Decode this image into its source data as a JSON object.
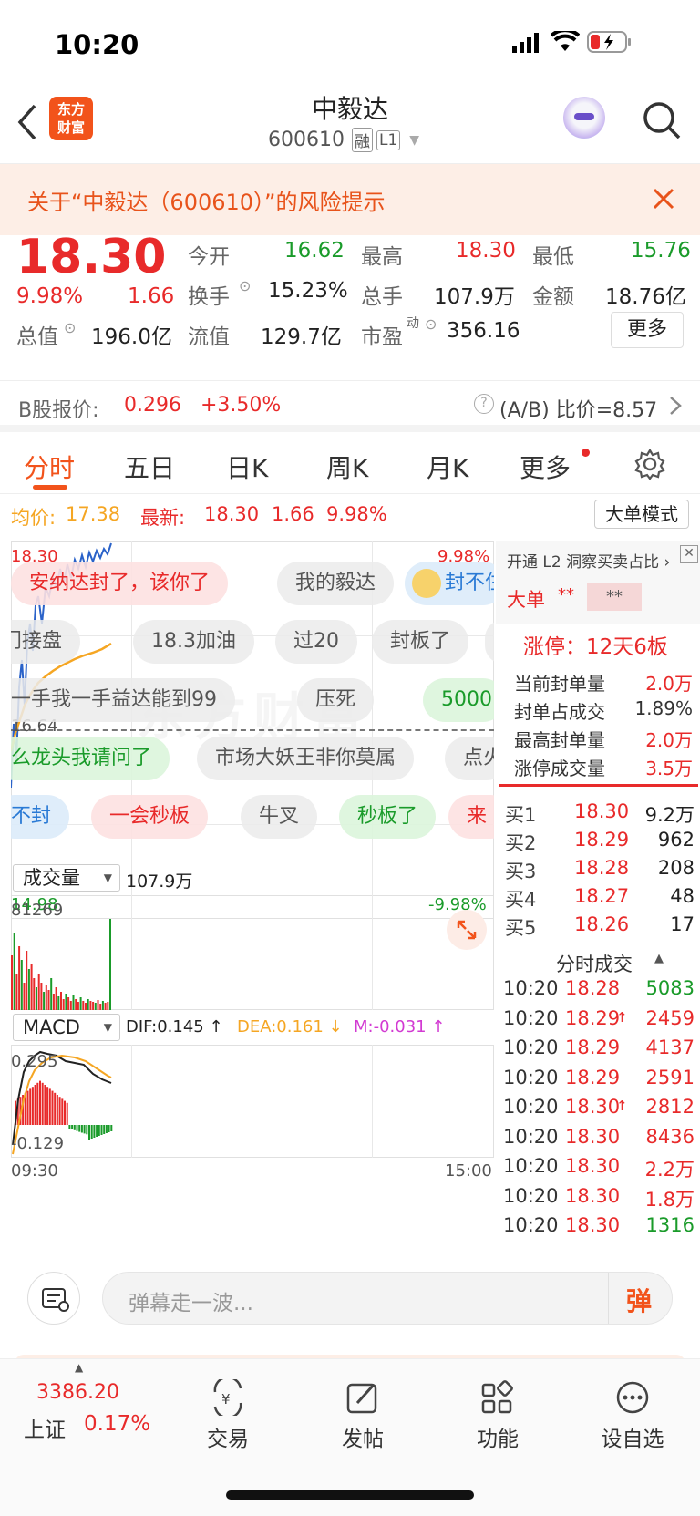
{
  "status": {
    "time": "10:20"
  },
  "header": {
    "logo_line1": "东方",
    "logo_line2": "财富",
    "name": "中毅达",
    "code": "600610",
    "badge1": "融",
    "badge2": "L1"
  },
  "risk": {
    "text": "关于“中毅达（600610）”的风险提示"
  },
  "quote": {
    "price": "18.30",
    "pct": "9.98%",
    "chg": "1.66",
    "open_label": "今开",
    "open": "16.62",
    "high_label": "最高",
    "high": "18.30",
    "low_label": "最低",
    "low": "15.76",
    "turnover_label": "换手",
    "turnover": "15.23%",
    "vol_label": "总手",
    "vol": "107.9万",
    "amt_label": "金额",
    "amt": "18.76亿",
    "mcap_label": "总值",
    "mcap": "196.0亿",
    "fcap_label": "流值",
    "fcap": "129.7亿",
    "pe_label": "市盈",
    "pe_sup": "动",
    "pe": "356.16",
    "more": "更多"
  },
  "bshare": {
    "label": "B股报价:",
    "price": "0.296",
    "pct": "+3.50%",
    "ratio": "(A/B) 比价=8.57"
  },
  "tabs": [
    "分时",
    "五日",
    "日K",
    "周K",
    "月K",
    "更多"
  ],
  "chart": {
    "avg_label": "均价:",
    "avg": "17.38",
    "new_label": "最新:",
    "new_price": "18.30",
    "new_chg": "1.66",
    "new_pct": "9.98%",
    "mode_btn": "大单模式",
    "top_price": "18.30",
    "top_pct": "9.98%",
    "mid_price": "16.64",
    "bottom_price": "14.98",
    "bottom_pct": "-9.98%",
    "vol_select": "成交量",
    "vol_total": "107.9万",
    "vol_max": "81269",
    "macd_select": "MACD",
    "dif": "DIF:0.145 ↑",
    "dea": "DEA:0.161 ↓",
    "m": "M:-0.031 ↑",
    "macd_top": "0.295",
    "macd_bottom": "-0.129",
    "time_start": "09:30",
    "time_end": "15:00",
    "watermark": "东方财富"
  },
  "danmu": [
    "安纳达封了，该你了",
    "我的毅达",
    "封不住",
    "门接盘",
    "18.3加油",
    "过20",
    "封板了",
    "一手我一手益达能到99",
    "压死",
    "5000",
    "么龙头我请问了",
    "市场大妖王非你莫属",
    "点火",
    "不封",
    "一会秒板",
    "牛叉",
    "秒板了",
    "来"
  ],
  "side": {
    "l2_title": "开通 L2 洞察买卖占比 ›",
    "big_label": "大单",
    "big_mask": "**",
    "big_mask2": "**",
    "limit_title": "涨停：12天6板",
    "stats": [
      {
        "label": "当前封单量",
        "value": "2.0万"
      },
      {
        "label": "封单占成交",
        "value": "1.89%"
      },
      {
        "label": "最高封单量",
        "value": "2.0万"
      },
      {
        "label": "涨停成交量",
        "value": "3.5万"
      }
    ],
    "bids": [
      {
        "label": "买1",
        "price": "18.30",
        "vol": "9.2万"
      },
      {
        "label": "买2",
        "price": "18.29",
        "vol": "962"
      },
      {
        "label": "买3",
        "price": "18.28",
        "vol": "208"
      },
      {
        "label": "买4",
        "price": "18.27",
        "vol": "48"
      },
      {
        "label": "买5",
        "price": "18.26",
        "vol": "17"
      }
    ],
    "trades_title": "分时成交",
    "trades": [
      {
        "t": "10:20",
        "p": "18.28",
        "a": "",
        "v": "5083",
        "c": "green"
      },
      {
        "t": "10:20",
        "p": "18.29",
        "a": "↑",
        "v": "2459",
        "c": "red"
      },
      {
        "t": "10:20",
        "p": "18.29",
        "a": "",
        "v": "4137",
        "c": "red"
      },
      {
        "t": "10:20",
        "p": "18.29",
        "a": "",
        "v": "2591",
        "c": "red"
      },
      {
        "t": "10:20",
        "p": "18.30",
        "a": "↑",
        "v": "2812",
        "c": "red"
      },
      {
        "t": "10:20",
        "p": "18.30",
        "a": "",
        "v": "8436",
        "c": "red"
      },
      {
        "t": "10:20",
        "p": "18.30",
        "a": "",
        "v": "2.2万",
        "c": "red"
      },
      {
        "t": "10:20",
        "p": "18.30",
        "a": "",
        "v": "1.8万",
        "c": "red"
      },
      {
        "t": "10:20",
        "p": "18.30",
        "a": "",
        "v": "1316",
        "c": "green"
      }
    ]
  },
  "input": {
    "placeholder": "弹幕走一波...",
    "danmu_btn": "弹"
  },
  "nav": {
    "index_value": "3386.20",
    "index_name": "上证",
    "index_pct": "0.17%",
    "items": [
      "交易",
      "发帖",
      "功能",
      "设自选"
    ]
  },
  "colors": {
    "red": "#e82a2a",
    "green": "#1a9b2a",
    "orange": "#f5a623",
    "blue": "#2a62c9",
    "brand": "#f2531b"
  }
}
